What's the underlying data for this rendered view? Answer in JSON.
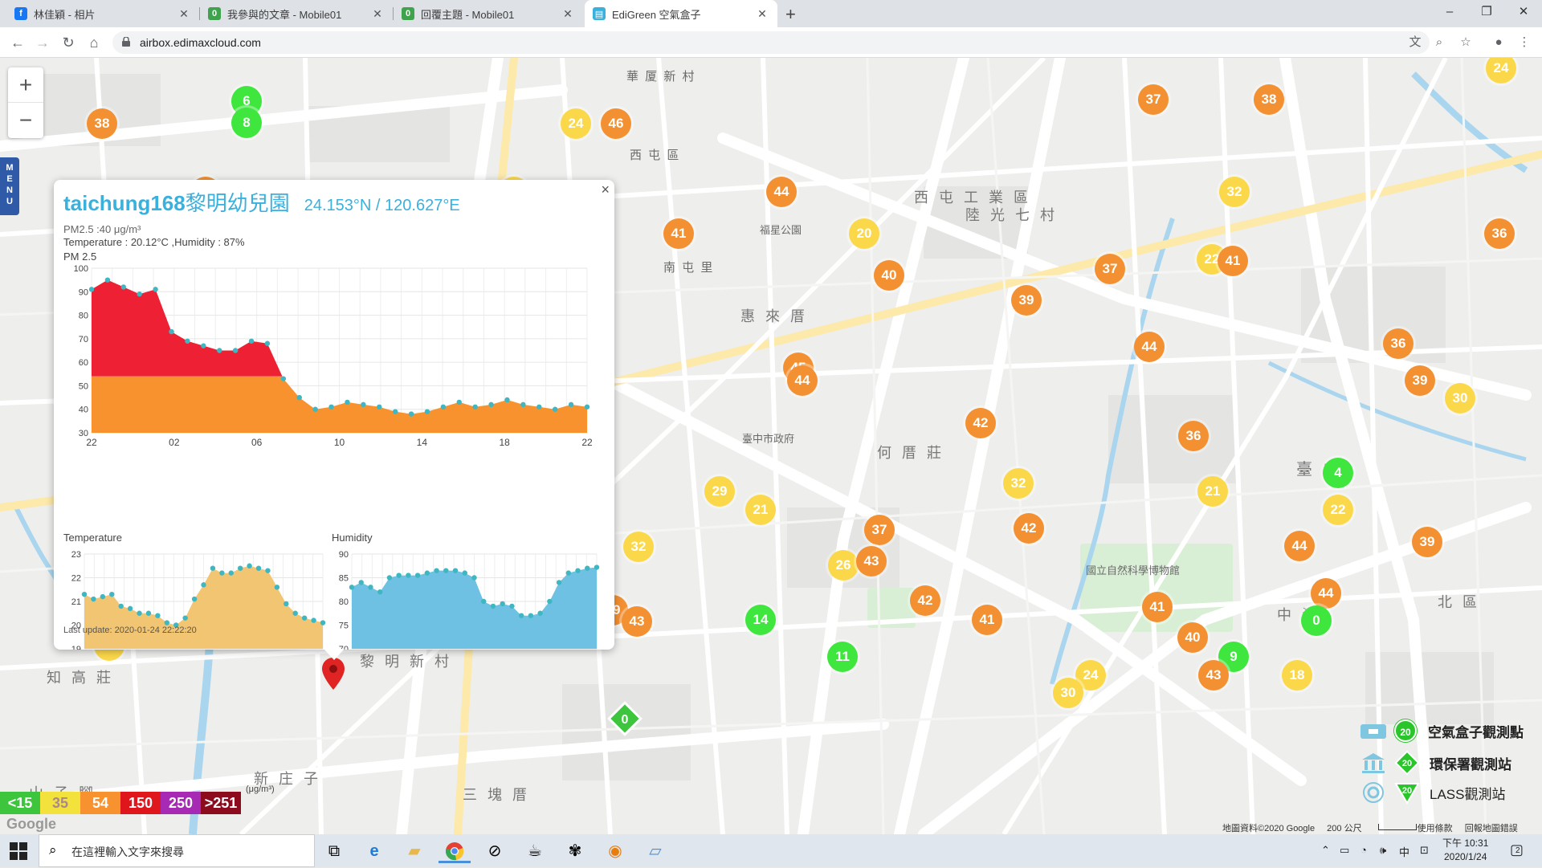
{
  "browser": {
    "tabs": [
      {
        "title": "林佳穎 - 相片",
        "icon": "facebook-icon",
        "color": "#1877f2"
      },
      {
        "title": "我參與的文章 - Mobile01",
        "icon": "mobile01-icon",
        "color": "#3ea34c"
      },
      {
        "title": "回覆主題 - Mobile01",
        "icon": "mobile01-icon",
        "color": "#3ea34c"
      },
      {
        "title": "EdiGreen 空氣盒子",
        "icon": "edigreen-icon",
        "color": "#3ab0dd"
      }
    ],
    "active_tab": 3,
    "url": "airbox.edimaxcloud.com"
  },
  "map": {
    "zoom_in": "+",
    "zoom_out": "−",
    "menu_label": "MENU",
    "place_labels": [
      {
        "text": "華 厦 新 村",
        "size": "normal"
      },
      {
        "text": "西 屯 區",
        "size": "normal"
      },
      {
        "text": "西 屯 工 業 區",
        "size": "big"
      },
      {
        "text": "陸 光 七 村",
        "size": "big"
      },
      {
        "text": "惠 來 厝",
        "size": "big"
      },
      {
        "text": "何 厝 莊",
        "size": "big"
      },
      {
        "text": "黎 明 新 村",
        "size": "big"
      },
      {
        "text": "知 高 莊",
        "size": "big"
      },
      {
        "text": "新 庄 子",
        "size": "big"
      },
      {
        "text": "三 塊 厝",
        "size": "big"
      },
      {
        "text": "山 子 腳",
        "size": "big"
      },
      {
        "text": "南 屯 里",
        "size": "normal"
      },
      {
        "text": "臺 中",
        "size": "big"
      },
      {
        "text": "中 海",
        "size": "big"
      },
      {
        "text": "北 區",
        "size": "big"
      },
      {
        "text": "國立自然科學博物館",
        "size": "normal"
      },
      {
        "text": "臺中市政府",
        "size": "normal"
      },
      {
        "text": "福星公園",
        "size": "normal"
      }
    ],
    "markers": [
      {
        "v": "38",
        "c": "orange"
      },
      {
        "v": "6",
        "c": "green"
      },
      {
        "v": "8",
        "c": "green"
      },
      {
        "v": "24",
        "c": "yellow"
      },
      {
        "v": "46",
        "c": "orange"
      },
      {
        "v": "37",
        "c": "orange"
      },
      {
        "v": "38",
        "c": "orange"
      },
      {
        "v": "24",
        "c": "yellow"
      },
      {
        "v": "39",
        "c": "orange"
      },
      {
        "v": "27",
        "c": "yellow"
      },
      {
        "v": "44",
        "c": "orange"
      },
      {
        "v": "32",
        "c": "yellow"
      },
      {
        "v": "41",
        "c": "orange"
      },
      {
        "v": "20",
        "c": "yellow"
      },
      {
        "v": "36",
        "c": "orange"
      },
      {
        "v": "22",
        "c": "yellow"
      },
      {
        "v": "41",
        "c": "orange"
      },
      {
        "v": "37",
        "c": "orange"
      },
      {
        "v": "40",
        "c": "orange"
      },
      {
        "v": "39",
        "c": "orange"
      },
      {
        "v": "44",
        "c": "orange"
      },
      {
        "v": "36",
        "c": "orange"
      },
      {
        "v": "45",
        "c": "orange"
      },
      {
        "v": "44",
        "c": "orange"
      },
      {
        "v": "39",
        "c": "orange"
      },
      {
        "v": "30",
        "c": "yellow"
      },
      {
        "v": "42",
        "c": "orange"
      },
      {
        "v": "36",
        "c": "orange"
      },
      {
        "v": "4",
        "c": "green"
      },
      {
        "v": "29",
        "c": "yellow"
      },
      {
        "v": "21",
        "c": "yellow"
      },
      {
        "v": "32",
        "c": "yellow"
      },
      {
        "v": "21",
        "c": "yellow"
      },
      {
        "v": "22",
        "c": "yellow"
      },
      {
        "v": "37",
        "c": "orange"
      },
      {
        "v": "42",
        "c": "orange"
      },
      {
        "v": "44",
        "c": "orange"
      },
      {
        "v": "39",
        "c": "orange"
      },
      {
        "v": "26",
        "c": "yellow"
      },
      {
        "v": "43",
        "c": "orange"
      },
      {
        "v": "32",
        "c": "yellow"
      },
      {
        "v": "40",
        "c": "orange"
      },
      {
        "v": "41",
        "c": "orange"
      },
      {
        "v": "38",
        "c": "orange"
      },
      {
        "v": "49",
        "c": "orange"
      },
      {
        "v": "43",
        "c": "orange"
      },
      {
        "v": "42",
        "c": "orange"
      },
      {
        "v": "41",
        "c": "orange"
      },
      {
        "v": "41",
        "c": "orange"
      },
      {
        "v": "44",
        "c": "orange"
      },
      {
        "v": "0",
        "c": "green"
      },
      {
        "v": "40",
        "c": "orange"
      },
      {
        "v": "14",
        "c": "green"
      },
      {
        "v": "40",
        "c": "orange"
      },
      {
        "v": "11",
        "c": "green"
      },
      {
        "v": "9",
        "c": "green"
      },
      {
        "v": "24",
        "c": "yellow"
      },
      {
        "v": "43",
        "c": "orange"
      },
      {
        "v": "18",
        "c": "yellow"
      },
      {
        "v": "30",
        "c": "yellow"
      },
      {
        "v": "24",
        "c": "yellow"
      }
    ],
    "diamond_marker": "0"
  },
  "popup": {
    "station": "taichung168",
    "station_name": "黎明幼兒園",
    "coords": "24.153°N / 120.627°E",
    "pm_line": "PM2.5 :40 μg/m³",
    "temp_line": "Temperature : 20.12°C ,Humidity : 87%",
    "pm_title": "PM 2.5",
    "temp_title": "Temperature",
    "hum_title": "Humidity",
    "last_update": "Last update: 2020-01-24 22:22:20",
    "close": "×"
  },
  "chart_data": [
    {
      "type": "area",
      "title": "PM 2.5",
      "x_ticks": [
        "22",
        "02",
        "06",
        "10",
        "14",
        "18",
        "22"
      ],
      "y_ticks": [
        100,
        90,
        80,
        70,
        60,
        50,
        40,
        30
      ],
      "ylim": [
        30,
        100
      ],
      "threshold": 54,
      "colors": {
        "below": "#f7922e",
        "above": "#ee2033"
      },
      "values": [
        91,
        95,
        92,
        89,
        91,
        73,
        69,
        67,
        65,
        65,
        69,
        68,
        53,
        45,
        40,
        41,
        43,
        42,
        41,
        39,
        38,
        39,
        41,
        43,
        41,
        42,
        44,
        42,
        41,
        40,
        42,
        41
      ]
    },
    {
      "type": "area",
      "title": "Temperature",
      "y_ticks": [
        23,
        22,
        21,
        20,
        19
      ],
      "ylim": [
        19,
        23
      ],
      "color": "#f2c572",
      "values": [
        21.3,
        21.1,
        21.2,
        21.3,
        20.8,
        20.7,
        20.5,
        20.5,
        20.4,
        20.1,
        20.0,
        20.3,
        21.1,
        21.7,
        22.4,
        22.2,
        22.2,
        22.4,
        22.5,
        22.4,
        22.3,
        21.6,
        20.9,
        20.5,
        20.3,
        20.2,
        20.1
      ]
    },
    {
      "type": "area",
      "title": "Humidity",
      "y_ticks": [
        90,
        85,
        80,
        75,
        70
      ],
      "ylim": [
        70,
        90
      ],
      "color": "#6fc1e3",
      "values": [
        83,
        84,
        83,
        82,
        85,
        85.5,
        85.5,
        85.5,
        86,
        86.5,
        86.5,
        86.5,
        86,
        85,
        80,
        79,
        79.5,
        79,
        77,
        77,
        77.5,
        80,
        84,
        86,
        86.5,
        87,
        87.2
      ]
    }
  ],
  "legend": {
    "aqi_bins": [
      {
        "label": "<15",
        "color": "#3ec53e"
      },
      {
        "label": "35",
        "color": "#f3e23b"
      },
      {
        "label": "54",
        "color": "#f7922e"
      },
      {
        "label": "150",
        "color": "#e0161d"
      },
      {
        "label": "250",
        "color": "#a62ab4"
      },
      {
        "label": ">251",
        "color": "#8c0c1e"
      }
    ],
    "unit": "(μg/m³)",
    "stations": [
      {
        "badge": "20",
        "label": "空氣盒子觀測點"
      },
      {
        "badge": "20",
        "label": "環保署觀測站"
      },
      {
        "badge": "20",
        "label": "LASS觀測站"
      }
    ],
    "attribution": "地圖資料©2020 Google",
    "scale": "200 公尺",
    "terms": "使用條款",
    "report": "回報地圖錯誤",
    "google": "Google"
  },
  "taskbar": {
    "search_placeholder": "在這裡輸入文字來搜尋",
    "time": "下午 10:31",
    "date": "2020/1/24",
    "ime": "中",
    "notify_count": "2"
  }
}
